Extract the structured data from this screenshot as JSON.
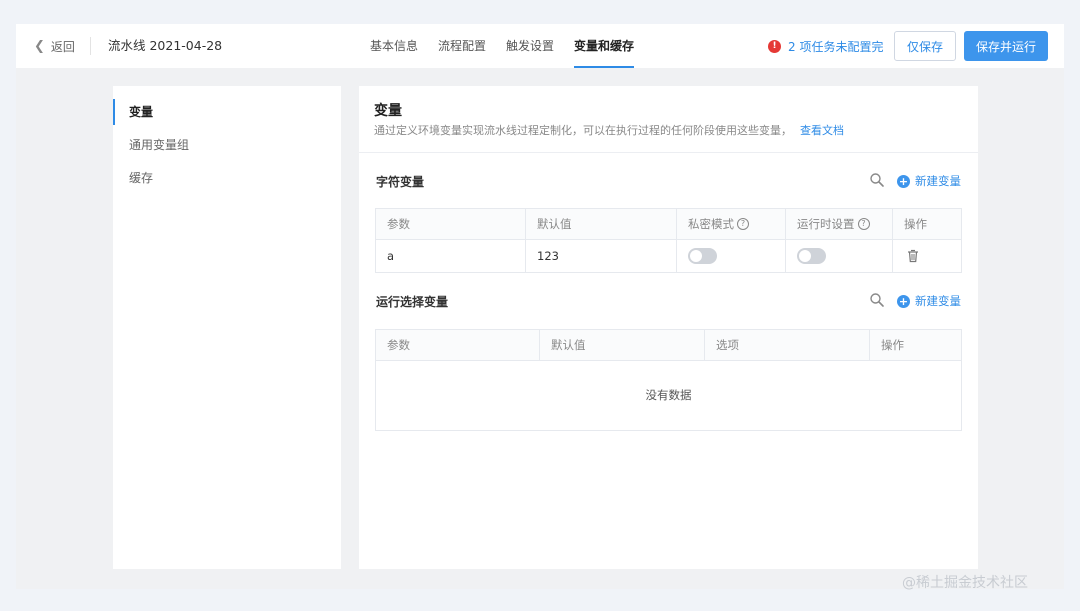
{
  "header": {
    "back_label": "返回",
    "pipeline_title": "流水线 2021-04-28",
    "tabs": [
      {
        "label": "基本信息"
      },
      {
        "label": "流程配置"
      },
      {
        "label": "触发设置"
      },
      {
        "label": "变量和缓存"
      }
    ],
    "active_tab": "变量和缓存",
    "warning_text": "2 项任务未配置完",
    "save_only_label": "仅保存",
    "save_run_label": "保存并运行"
  },
  "sidebar": {
    "items": [
      {
        "label": "变量"
      },
      {
        "label": "通用变量组"
      },
      {
        "label": "缓存"
      }
    ],
    "active": "变量"
  },
  "main": {
    "title": "变量",
    "description": "通过定义环境变量实现流水线过程定制化，可以在执行过程的任何阶段使用这些变量，",
    "doc_link": "查看文档",
    "string_vars": {
      "title": "字符变量",
      "new_label": "新建变量",
      "columns": [
        "参数",
        "默认值",
        "私密模式",
        "运行时设置",
        "操作"
      ],
      "rows": [
        {
          "param": "a",
          "default": "123",
          "private": false,
          "runtime": false
        }
      ]
    },
    "select_vars": {
      "title": "运行选择变量",
      "new_label": "新建变量",
      "columns": [
        "参数",
        "默认值",
        "选项",
        "操作"
      ],
      "empty_text": "没有数据"
    }
  },
  "watermark": "@稀土掘金技术社区",
  "colors": {
    "accent": "#2e8be6",
    "primary_button": "#3d95ec",
    "warning": "#e53935",
    "page_bg": "#f0f3f8"
  },
  "icons": [
    "chevron-left-icon",
    "warning-icon",
    "search-icon",
    "plus-circle-icon",
    "help-icon",
    "trash-icon"
  ]
}
